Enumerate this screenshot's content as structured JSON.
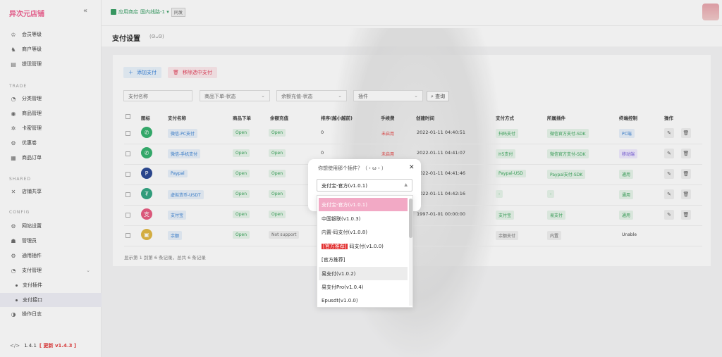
{
  "app": {
    "title": "异次元店铺",
    "collapse_icon": "chevron-left-icon"
  },
  "topbar": {
    "store_label": "应用商店",
    "line_label": "国内线路-1 ▾",
    "sync_label": "同发"
  },
  "sidebar": {
    "items": [
      {
        "icon": "crown-icon",
        "glyph": "♔",
        "label": "会员等级"
      },
      {
        "icon": "merchant-icon",
        "glyph": "♞",
        "label": "商户等级"
      },
      {
        "icon": "withdraw-icon",
        "glyph": "▤",
        "label": "提现管理"
      }
    ],
    "trade_title": "TRADE",
    "trade_items": [
      {
        "icon": "category-icon",
        "glyph": "◔",
        "label": "分类管理"
      },
      {
        "icon": "goods-icon",
        "glyph": "◉",
        "label": "商品管理"
      },
      {
        "icon": "card-icon",
        "glyph": "✲",
        "label": "卡密管理"
      },
      {
        "icon": "coupon-icon",
        "glyph": "⚙",
        "label": "优惠卷"
      },
      {
        "icon": "order-icon",
        "glyph": "▦",
        "label": "商品订单"
      }
    ],
    "shared_title": "SHARED",
    "shared_items": [
      {
        "icon": "share-icon",
        "glyph": "✕",
        "label": "店铺共享"
      }
    ],
    "config_title": "CONFIG",
    "config_items": [
      {
        "icon": "settings-icon",
        "glyph": "⚙",
        "label": "网站设置"
      },
      {
        "icon": "admin-icon",
        "glyph": "☗",
        "label": "管理员"
      },
      {
        "icon": "plugin-icon",
        "glyph": "⚙",
        "label": "通用插件"
      },
      {
        "icon": "payment-icon",
        "glyph": "◔",
        "label": "支付管理"
      }
    ],
    "payment_sub": [
      {
        "label": "支付插件"
      },
      {
        "label": "支付接口"
      }
    ],
    "log_item": {
      "icon": "log-icon",
      "glyph": "◑",
      "label": "操作日志"
    },
    "version": "1.4.1",
    "update": "[ 更新 v1.4.3 ]"
  },
  "page": {
    "title": "支付设置",
    "kaomoji": "(ʘᴗʘ)"
  },
  "toolbar": {
    "add_label": "添加支付",
    "delete_label": "移除选中支付"
  },
  "filters": {
    "name_placeholder": "支付名称",
    "goods_status": "商品下单-状态",
    "balance_status": "余额充值-状态",
    "plugin": "插件",
    "search_label": "查询"
  },
  "table": {
    "headers": [
      "图标",
      "支付名称",
      "商品下单",
      "余额充值",
      "排序(越小越前)",
      "手续费",
      "创建时间",
      "支付方式",
      "所属插件",
      "终端控制",
      "操作"
    ],
    "rows": [
      {
        "icon": "wechat-icon",
        "icon_color": "#2aae67",
        "glyph": "✆",
        "name": "微信-PC支付",
        "goods": "Open",
        "balance": "Open",
        "sort": "0",
        "fee": "未启用",
        "time": "2022-01-11 04:40:51",
        "method": "扫码支付",
        "plugin": "微信官方支付-SDK",
        "terminal": "PC端",
        "terminal_style": "blue"
      },
      {
        "icon": "wechat-icon",
        "icon_color": "#2aae67",
        "glyph": "✆",
        "name": "微信-手机支付",
        "goods": "Open",
        "balance": "Open",
        "sort": "0",
        "fee": "未启用",
        "time": "2022-01-11 04:41:07",
        "method": "H5支付",
        "plugin": "微信官方支付-SDK",
        "terminal": "移动端",
        "terminal_style": "purple"
      },
      {
        "icon": "paypal-icon",
        "icon_color": "#1f3f8f",
        "glyph": "P",
        "name": "Paypal",
        "goods": "Open",
        "balance": "Open",
        "sort": "",
        "fee": "",
        "time": "2022-01-11 04:41:46",
        "method": "Paypal-USD",
        "plugin": "Paypal支付-SDK",
        "terminal": "通用",
        "terminal_style": "green"
      },
      {
        "icon": "tether-icon",
        "icon_color": "#26a17b",
        "glyph": "₮",
        "name": "虚拟货币-USDT",
        "goods": "Open",
        "balance": "Open",
        "sort": "",
        "fee": "",
        "time": "2022-01-11 04:42:16",
        "method": "-",
        "plugin": "-",
        "terminal": "通用",
        "terminal_style": "green"
      },
      {
        "icon": "alipay-icon",
        "icon_color": "#e8527a",
        "glyph": "支",
        "name": "支付宝",
        "goods": "Open",
        "balance": "Open",
        "sort": "",
        "fee": "",
        "time": "1997-01-01 00:00:00",
        "method": "支付宝",
        "plugin": "易支付",
        "terminal": "通用",
        "terminal_style": "green"
      },
      {
        "icon": "wallet-icon",
        "icon_color": "#e0b43a",
        "glyph": "▣",
        "name": "余额",
        "goods": "Open",
        "balance": "Not support",
        "sort": "",
        "fee": "",
        "time": "",
        "method": "余额支付",
        "plugin": "内置",
        "terminal": "Unable",
        "terminal_style": "gray"
      }
    ],
    "footer": "显示第 1 到第 6 条记录，总共 6 条记录"
  },
  "modal": {
    "title": "你想使用那个插件？（・ω・）",
    "selected": "支付宝-官方(v1.0.1)",
    "options": [
      {
        "label": "支付宝-官方(v1.0.1)",
        "state": "selected"
      },
      {
        "label": "中国银联(v1.0.3)",
        "state": ""
      },
      {
        "label": "内置-码支付(v1.0.8)",
        "state": ""
      },
      {
        "rec": "[官方推荐]",
        "label": "码支付(v1.0.0)",
        "state": ""
      },
      {
        "label": "[官方推荐]",
        "state": ""
      },
      {
        "label": "易支付(v1.0.2)",
        "state": "hover"
      },
      {
        "label": "易支付Pro(v1.0.4)",
        "state": ""
      },
      {
        "label": "Epusdt(v1.0.0)",
        "state": ""
      }
    ]
  }
}
